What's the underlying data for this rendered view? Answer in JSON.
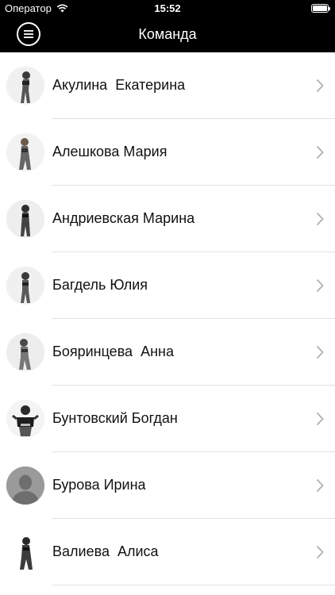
{
  "status_bar": {
    "carrier": "Оператор",
    "time": "15:52",
    "wifi_icon": "wifi-icon",
    "battery_icon": "battery-icon"
  },
  "nav_bar": {
    "title": "Команда",
    "menu_icon": "menu-icon"
  },
  "team": [
    {
      "name": "Акулина  Екатерина",
      "avatar": "photo"
    },
    {
      "name": "Алешкова Мария",
      "avatar": "photo"
    },
    {
      "name": "Андриевская Марина",
      "avatar": "photo"
    },
    {
      "name": "Багдель Юлия",
      "avatar": "photo"
    },
    {
      "name": "Бояринцева  Анна",
      "avatar": "photo"
    },
    {
      "name": "Бунтовский Богдан",
      "avatar": "photo"
    },
    {
      "name": "Бурова Ирина",
      "avatar": "placeholder"
    },
    {
      "name": "Валиева  Алиса",
      "avatar": "photo"
    }
  ],
  "colors": {
    "bar_background": "#000000",
    "bar_text": "#ffffff",
    "list_text": "#111111",
    "separator": "#e2e2e2",
    "chevron": "#b0b0b0",
    "placeholder_avatar": "#9a9a9a"
  }
}
